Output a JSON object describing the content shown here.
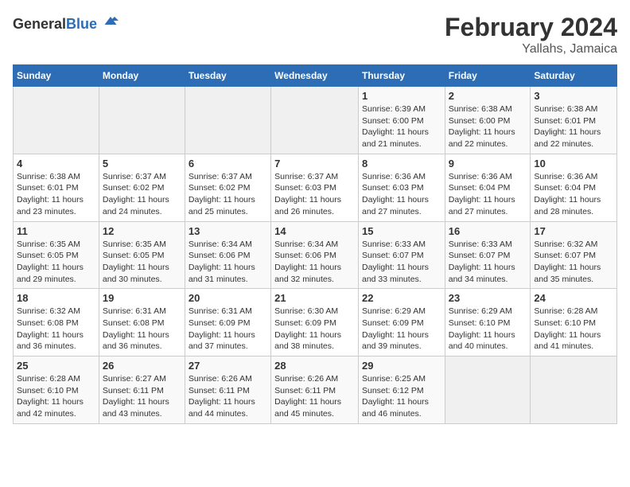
{
  "header": {
    "logo_general": "General",
    "logo_blue": "Blue",
    "title": "February 2024",
    "subtitle": "Yallahs, Jamaica"
  },
  "days_of_week": [
    "Sunday",
    "Monday",
    "Tuesday",
    "Wednesday",
    "Thursday",
    "Friday",
    "Saturday"
  ],
  "weeks": [
    [
      {
        "day": "",
        "content": ""
      },
      {
        "day": "",
        "content": ""
      },
      {
        "day": "",
        "content": ""
      },
      {
        "day": "",
        "content": ""
      },
      {
        "day": "1",
        "content": "Sunrise: 6:39 AM\nSunset: 6:00 PM\nDaylight: 11 hours and 21 minutes."
      },
      {
        "day": "2",
        "content": "Sunrise: 6:38 AM\nSunset: 6:00 PM\nDaylight: 11 hours and 22 minutes."
      },
      {
        "day": "3",
        "content": "Sunrise: 6:38 AM\nSunset: 6:01 PM\nDaylight: 11 hours and 22 minutes."
      }
    ],
    [
      {
        "day": "4",
        "content": "Sunrise: 6:38 AM\nSunset: 6:01 PM\nDaylight: 11 hours and 23 minutes."
      },
      {
        "day": "5",
        "content": "Sunrise: 6:37 AM\nSunset: 6:02 PM\nDaylight: 11 hours and 24 minutes."
      },
      {
        "day": "6",
        "content": "Sunrise: 6:37 AM\nSunset: 6:02 PM\nDaylight: 11 hours and 25 minutes."
      },
      {
        "day": "7",
        "content": "Sunrise: 6:37 AM\nSunset: 6:03 PM\nDaylight: 11 hours and 26 minutes."
      },
      {
        "day": "8",
        "content": "Sunrise: 6:36 AM\nSunset: 6:03 PM\nDaylight: 11 hours and 27 minutes."
      },
      {
        "day": "9",
        "content": "Sunrise: 6:36 AM\nSunset: 6:04 PM\nDaylight: 11 hours and 27 minutes."
      },
      {
        "day": "10",
        "content": "Sunrise: 6:36 AM\nSunset: 6:04 PM\nDaylight: 11 hours and 28 minutes."
      }
    ],
    [
      {
        "day": "11",
        "content": "Sunrise: 6:35 AM\nSunset: 6:05 PM\nDaylight: 11 hours and 29 minutes."
      },
      {
        "day": "12",
        "content": "Sunrise: 6:35 AM\nSunset: 6:05 PM\nDaylight: 11 hours and 30 minutes."
      },
      {
        "day": "13",
        "content": "Sunrise: 6:34 AM\nSunset: 6:06 PM\nDaylight: 11 hours and 31 minutes."
      },
      {
        "day": "14",
        "content": "Sunrise: 6:34 AM\nSunset: 6:06 PM\nDaylight: 11 hours and 32 minutes."
      },
      {
        "day": "15",
        "content": "Sunrise: 6:33 AM\nSunset: 6:07 PM\nDaylight: 11 hours and 33 minutes."
      },
      {
        "day": "16",
        "content": "Sunrise: 6:33 AM\nSunset: 6:07 PM\nDaylight: 11 hours and 34 minutes."
      },
      {
        "day": "17",
        "content": "Sunrise: 6:32 AM\nSunset: 6:07 PM\nDaylight: 11 hours and 35 minutes."
      }
    ],
    [
      {
        "day": "18",
        "content": "Sunrise: 6:32 AM\nSunset: 6:08 PM\nDaylight: 11 hours and 36 minutes."
      },
      {
        "day": "19",
        "content": "Sunrise: 6:31 AM\nSunset: 6:08 PM\nDaylight: 11 hours and 36 minutes."
      },
      {
        "day": "20",
        "content": "Sunrise: 6:31 AM\nSunset: 6:09 PM\nDaylight: 11 hours and 37 minutes."
      },
      {
        "day": "21",
        "content": "Sunrise: 6:30 AM\nSunset: 6:09 PM\nDaylight: 11 hours and 38 minutes."
      },
      {
        "day": "22",
        "content": "Sunrise: 6:29 AM\nSunset: 6:09 PM\nDaylight: 11 hours and 39 minutes."
      },
      {
        "day": "23",
        "content": "Sunrise: 6:29 AM\nSunset: 6:10 PM\nDaylight: 11 hours and 40 minutes."
      },
      {
        "day": "24",
        "content": "Sunrise: 6:28 AM\nSunset: 6:10 PM\nDaylight: 11 hours and 41 minutes."
      }
    ],
    [
      {
        "day": "25",
        "content": "Sunrise: 6:28 AM\nSunset: 6:10 PM\nDaylight: 11 hours and 42 minutes."
      },
      {
        "day": "26",
        "content": "Sunrise: 6:27 AM\nSunset: 6:11 PM\nDaylight: 11 hours and 43 minutes."
      },
      {
        "day": "27",
        "content": "Sunrise: 6:26 AM\nSunset: 6:11 PM\nDaylight: 11 hours and 44 minutes."
      },
      {
        "day": "28",
        "content": "Sunrise: 6:26 AM\nSunset: 6:11 PM\nDaylight: 11 hours and 45 minutes."
      },
      {
        "day": "29",
        "content": "Sunrise: 6:25 AM\nSunset: 6:12 PM\nDaylight: 11 hours and 46 minutes."
      },
      {
        "day": "",
        "content": ""
      },
      {
        "day": "",
        "content": ""
      }
    ]
  ]
}
